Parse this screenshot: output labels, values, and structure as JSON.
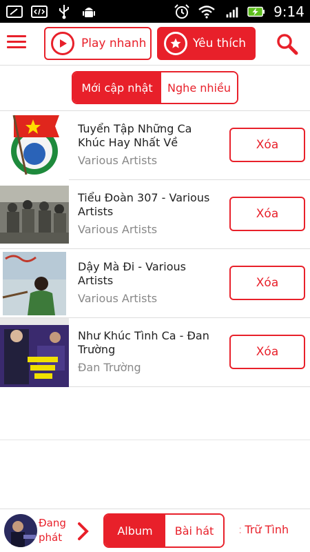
{
  "status_bar": {
    "time": "9:14",
    "left_icons": [
      "screenshot-icon",
      "code-icon",
      "usb-icon",
      "android-debug-icon"
    ],
    "right_icons": [
      "alarm-icon",
      "wifi-icon",
      "signal-icon",
      "battery-charging-icon"
    ]
  },
  "toolbar": {
    "play_label": "Play nhanh",
    "favorite_label": "Yêu thích"
  },
  "tabs": {
    "items": [
      {
        "label": "Mới cập nhật",
        "active": true
      },
      {
        "label": "Nghe nhiều",
        "active": false
      }
    ]
  },
  "albums": [
    {
      "title": "Tuyển Tập Những Ca Khúc Hay Nhất Về Ngày…",
      "artist": "Various Artists",
      "delete_label": "Xóa"
    },
    {
      "title": "Tiểu Đoàn 307 - Various Artists",
      "artist": "Various Artists",
      "delete_label": "Xóa"
    },
    {
      "title": "Dậy Mà Đi - Various Artists",
      "artist": "Various Artists",
      "delete_label": "Xóa"
    },
    {
      "title": "Như Khúc Tình Ca - Đan Trường",
      "artist": "Đan Trường",
      "delete_label": "Xóa"
    }
  ],
  "bottom_bar": {
    "now_playing": "Đang phát",
    "tabs": [
      {
        "label": "Album",
        "active": true
      },
      {
        "label": "Bài hát",
        "active": false
      }
    ],
    "genre_label": "Trữ Tình"
  },
  "colors": {
    "accent": "#e8202a",
    "muted_text": "#888888",
    "divider": "#dddddd"
  }
}
